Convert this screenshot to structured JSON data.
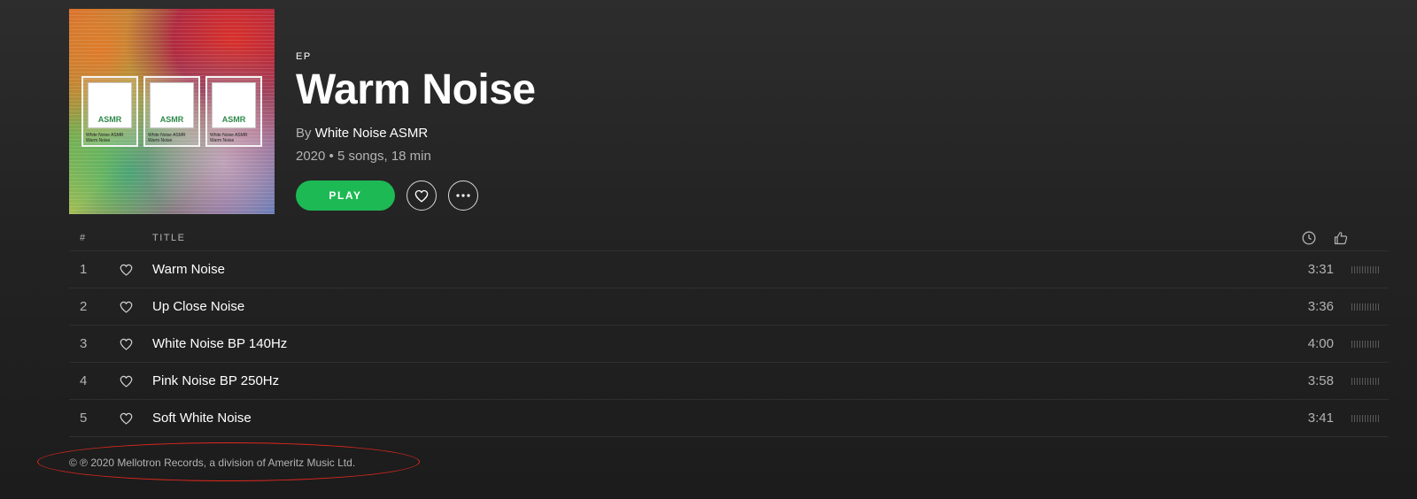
{
  "album": {
    "cover_tiles": [
      {
        "logo": "ASMR",
        "caption_line1": "White Noise ASMR",
        "caption_line2": "Warm Noise"
      },
      {
        "logo": "ASMR",
        "caption_line1": "White Noise ASMR",
        "caption_line2": "Warm Noise"
      },
      {
        "logo": "ASMR",
        "caption_line1": "White Noise ASMR",
        "caption_line2": "Warm Noise"
      }
    ],
    "type": "EP",
    "title": "Warm Noise",
    "by_prefix": "By",
    "artist": "White Noise ASMR",
    "meta": "2020 • 5 songs, 18 min",
    "play_label": "PLAY"
  },
  "tracklist": {
    "headers": {
      "number": "#",
      "title": "TITLE"
    },
    "tracks": [
      {
        "number": "1",
        "title": "Warm Noise",
        "duration": "3:31"
      },
      {
        "number": "2",
        "title": "Up Close Noise",
        "duration": "3:36"
      },
      {
        "number": "3",
        "title": "White Noise BP 140Hz",
        "duration": "4:00"
      },
      {
        "number": "4",
        "title": "Pink Noise BP 250Hz",
        "duration": "3:58"
      },
      {
        "number": "5",
        "title": "Soft White Noise",
        "duration": "3:41"
      }
    ]
  },
  "footer": {
    "copyright": "© ℗ 2020 Mellotron Records, a division of Ameritz Music Ltd."
  },
  "colors": {
    "accent": "#1db954",
    "annotation": "#e0281e",
    "background": "#232323",
    "text_secondary": "#b3b3b3"
  },
  "icons": [
    "heart-icon",
    "more-icon",
    "clock-icon",
    "thumbs-up-icon"
  ]
}
